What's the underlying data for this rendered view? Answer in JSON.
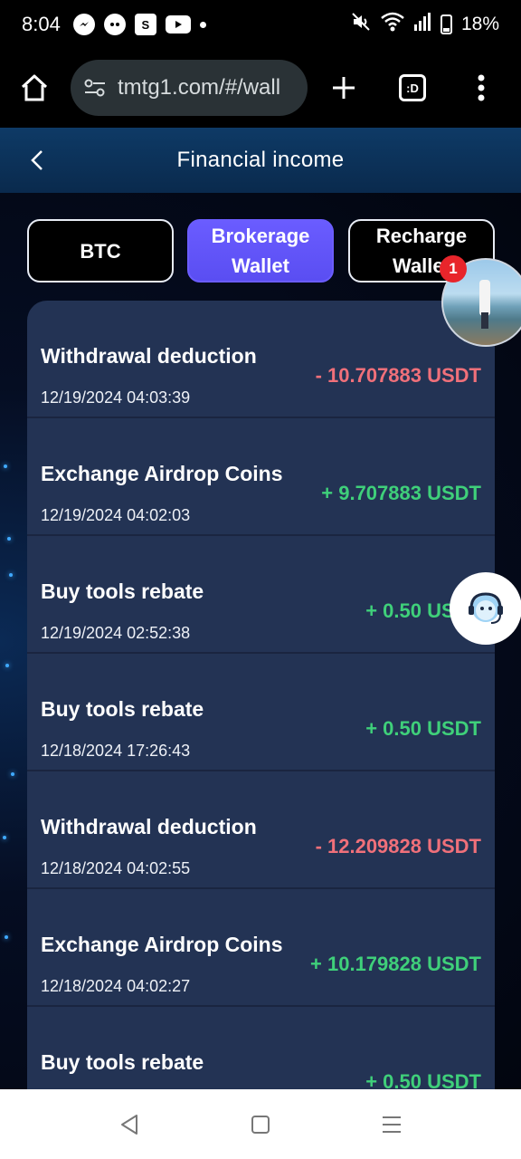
{
  "status_bar": {
    "time": "8:04",
    "battery": "18%",
    "icons_left": [
      "messenger-icon",
      "chat-icon",
      "shopee-icon",
      "youtube-icon",
      "dot-icon"
    ],
    "icons_right": [
      "mute-icon",
      "wifi-icon",
      "signal-icon",
      "battery-icon"
    ]
  },
  "browser": {
    "url": "tmtg1.com/#/wall",
    "tab_label": ":D"
  },
  "header": {
    "title": "Financial income"
  },
  "tabs": [
    {
      "label_line1": "BTC",
      "label_line2": ""
    },
    {
      "label_line1": "Brokerage",
      "label_line2": "Wallet"
    },
    {
      "label_line1": "Recharge",
      "label_line2": "Wallet"
    }
  ],
  "notification_count": "1",
  "transactions": [
    {
      "title": "Withdrawal deduction",
      "date": "12/19/2024 04:03:39",
      "amount": "- 10.707883 USDT",
      "type": "neg"
    },
    {
      "title": "Exchange Airdrop Coins",
      "date": "12/19/2024 04:02:03",
      "amount": "+ 9.707883 USDT",
      "type": "pos"
    },
    {
      "title": "Buy tools rebate",
      "date": "12/19/2024 02:52:38",
      "amount": "+ 0.50 USDT",
      "type": "pos"
    },
    {
      "title": "Buy tools rebate",
      "date": "12/18/2024 17:26:43",
      "amount": "+ 0.50 USDT",
      "type": "pos"
    },
    {
      "title": "Withdrawal deduction",
      "date": "12/18/2024 04:02:55",
      "amount": "- 12.209828 USDT",
      "type": "neg"
    },
    {
      "title": "Exchange Airdrop Coins",
      "date": "12/18/2024 04:02:27",
      "amount": "+ 10.179828 USDT",
      "type": "pos"
    },
    {
      "title": "Buy tools rebate",
      "date": "",
      "amount": "+ 0.50 USDT",
      "type": "pos"
    }
  ],
  "colors": {
    "accent": "#5a4ef2",
    "negative": "#f0707a",
    "positive": "#3fd07a",
    "panel": "#233354"
  }
}
